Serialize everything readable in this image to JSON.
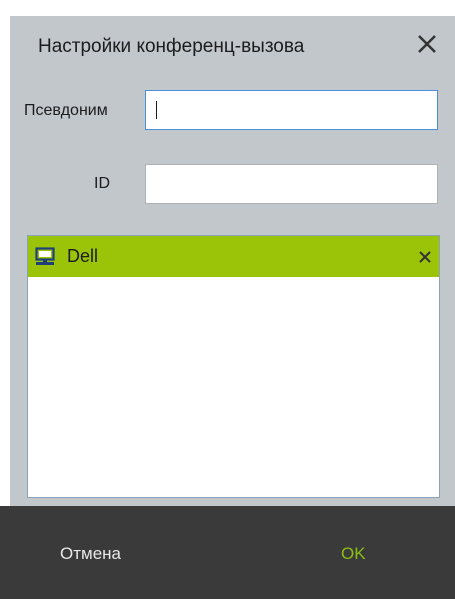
{
  "dialog": {
    "title": "Настройки конференц-вызова",
    "close_icon": "close-icon"
  },
  "form": {
    "alias_label": "Псевдоним",
    "alias_value": "",
    "id_label": "ID",
    "id_value": ""
  },
  "participants": {
    "items": [
      {
        "label": "Dell",
        "icon": "computer-icon",
        "remove_icon": "close-icon"
      }
    ]
  },
  "footer": {
    "cancel_label": "Отмена",
    "ok_label": "OK"
  },
  "colors": {
    "selected_item": "#9bc409",
    "ok_text": "#8bbf12",
    "footer_bg": "#3a3a3a",
    "panel_bg": "#c2c7cc",
    "focus_border": "#4a90d9"
  }
}
